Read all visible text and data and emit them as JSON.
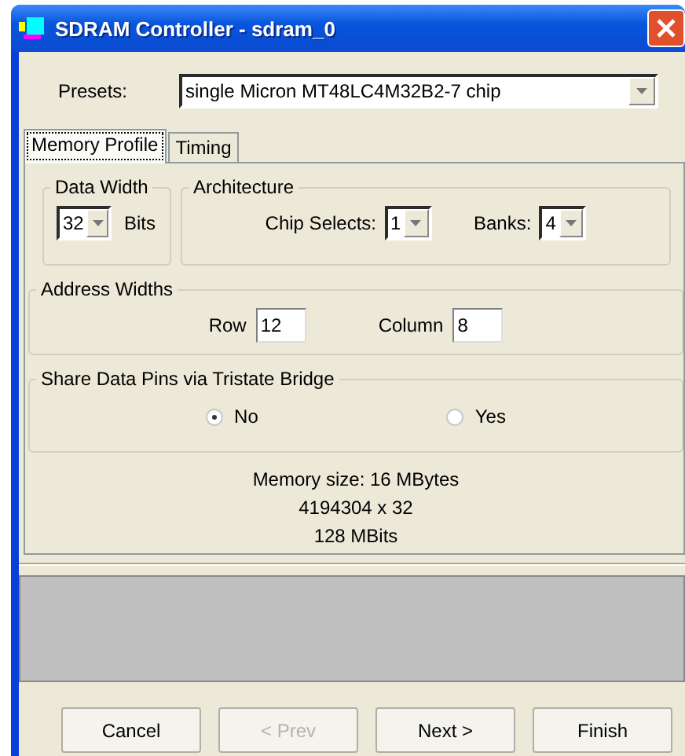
{
  "window": {
    "title": "SDRAM Controller - sdram_0"
  },
  "presets": {
    "label": "Presets:",
    "value": "single Micron MT48LC4M32B2-7 chip"
  },
  "tabs": [
    {
      "label": "Memory Profile",
      "selected": true
    },
    {
      "label": "Timing",
      "selected": false
    }
  ],
  "data_width": {
    "title": "Data Width",
    "value": "32",
    "unit": "Bits"
  },
  "architecture": {
    "title": "Architecture",
    "fields": [
      {
        "label": "Chip Selects:",
        "value": "1"
      },
      {
        "label": "Banks:",
        "value": "4"
      }
    ]
  },
  "address_widths": {
    "title": "Address Widths",
    "fields": [
      {
        "label": "Row",
        "value": "12"
      },
      {
        "label": "Column",
        "value": "8"
      }
    ]
  },
  "share_data_pins": {
    "title": "Share Data Pins via Tristate Bridge",
    "options": [
      {
        "label": "No",
        "selected": true
      },
      {
        "label": "Yes",
        "selected": false
      }
    ]
  },
  "memory_info": [
    "Memory size: 16 MBytes",
    "4194304 x 32",
    "128 MBits"
  ],
  "buttons": [
    {
      "label": "Cancel",
      "disabled": false
    },
    {
      "label": "< Prev",
      "disabled": true
    },
    {
      "label": "Next >",
      "disabled": false
    },
    {
      "label": "Finish",
      "disabled": false
    }
  ]
}
